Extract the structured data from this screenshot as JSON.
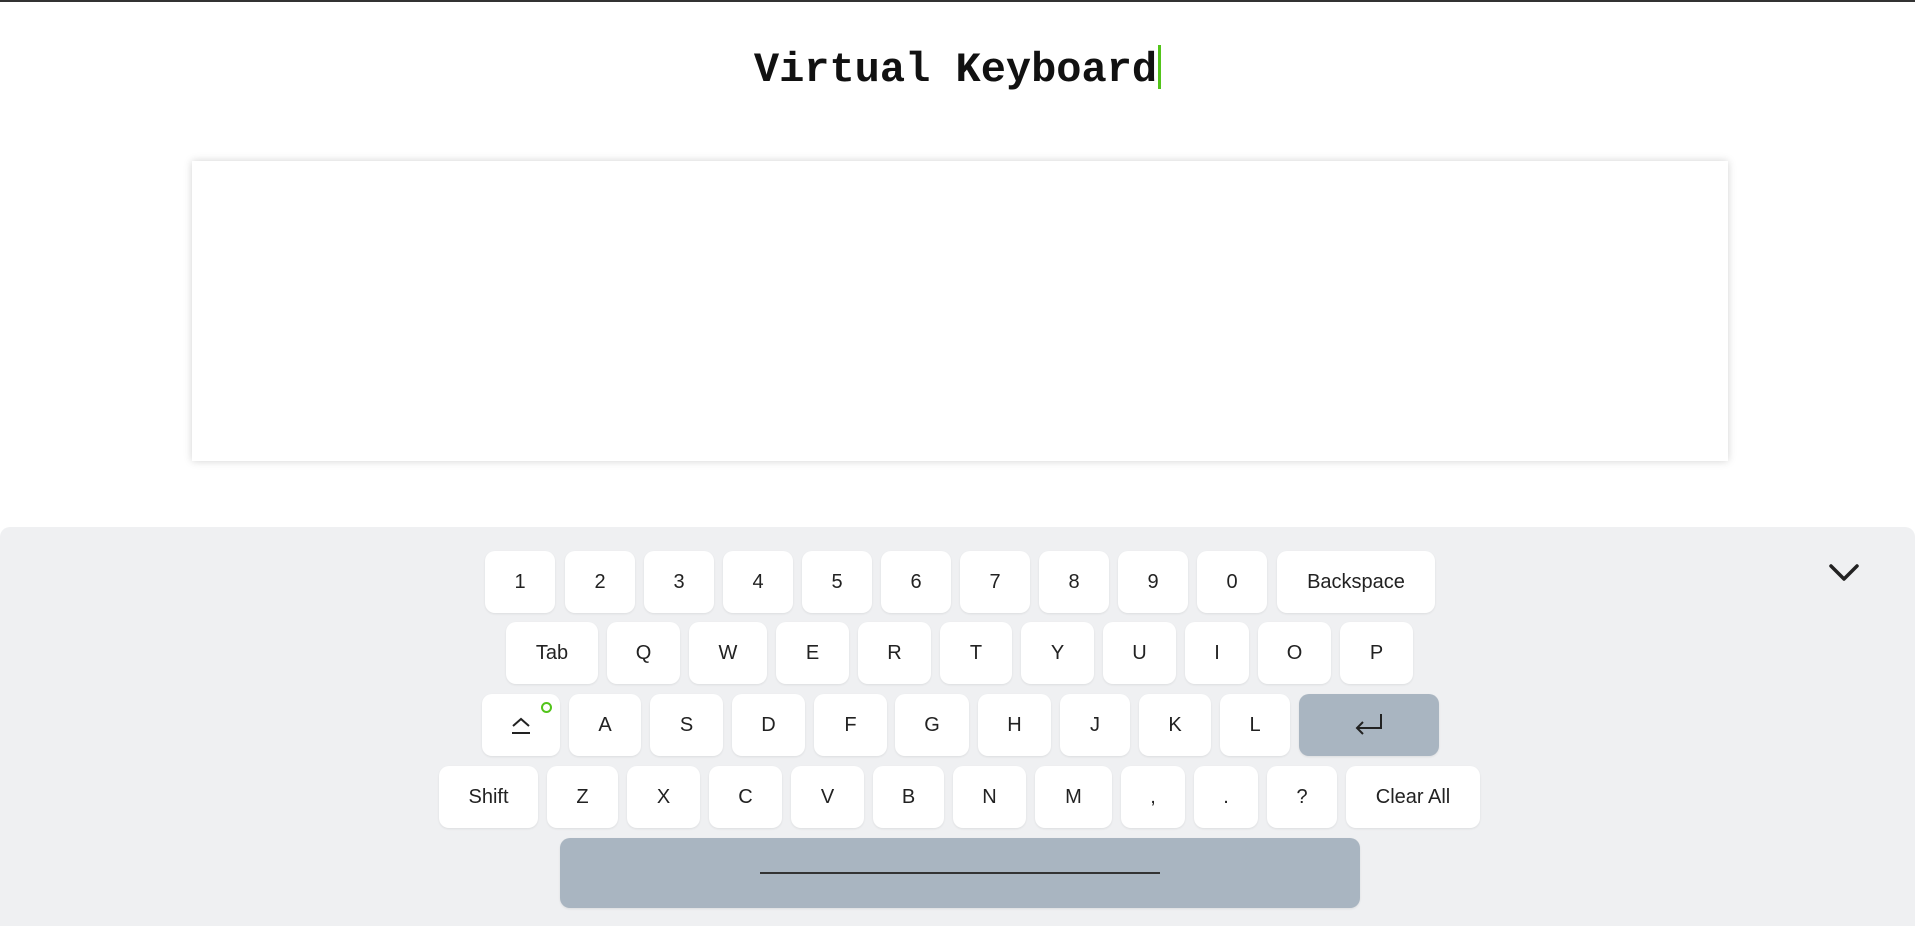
{
  "title": "Virtual Keyboard",
  "colors": {
    "accent": "#52c41a",
    "keyboard_bg": "#eff0f2",
    "key_bg": "#ffffff",
    "special_key_bg": "#a9b5c1"
  },
  "textarea": {
    "value": ""
  },
  "keyboard": {
    "collapse_icon": "chevron-down-icon",
    "caps_icon": "caps-lock-icon",
    "enter_icon": "enter-icon",
    "rows": [
      [
        "1",
        "2",
        "3",
        "4",
        "5",
        "6",
        "7",
        "8",
        "9",
        "0",
        "Backspace"
      ],
      [
        "Tab",
        "Q",
        "W",
        "E",
        "R",
        "T",
        "Y",
        "U",
        "I",
        "O",
        "P"
      ],
      [
        "A",
        "S",
        "D",
        "F",
        "G",
        "H",
        "J",
        "K",
        "L"
      ],
      [
        "Shift",
        "Z",
        "X",
        "C",
        "V",
        "B",
        "N",
        "M",
        ",",
        ".",
        "?",
        "Clear All"
      ]
    ]
  }
}
